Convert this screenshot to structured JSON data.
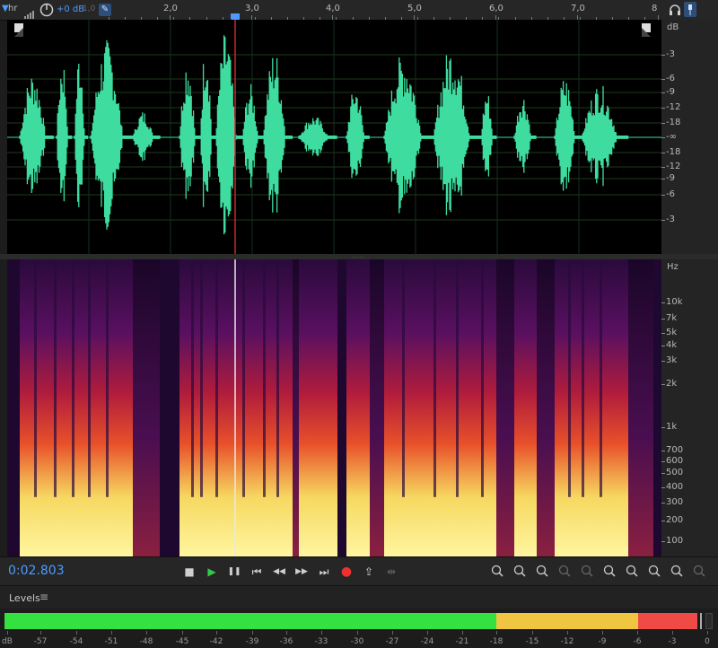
{
  "ruler": {
    "left_labels": {
      "partial": "hr",
      "gain": "+0 dB",
      "faint": "1,0"
    },
    "ticks": [
      "2,0",
      "3,0",
      "4,0",
      "5,0",
      "6,0",
      "7,0",
      "8"
    ]
  },
  "db_scale": {
    "unit": "dB",
    "top_labels": [
      "-3",
      "-6",
      "-9",
      "-12",
      "-18"
    ],
    "center": "-∞",
    "bottom_labels": [
      "-18",
      "-12",
      "-9",
      "-6",
      "-3"
    ]
  },
  "hz_scale": {
    "unit": "Hz",
    "labels": [
      "10k",
      "7k",
      "5k",
      "4k",
      "3k",
      "2k",
      "1k",
      "700",
      "600",
      "500",
      "400",
      "300",
      "200",
      "100"
    ]
  },
  "transport": {
    "time": "0:02.803",
    "buttons": {
      "stop": "■",
      "play": "▶",
      "pause": "❚❚",
      "to_start": "⏮",
      "rewind": "◀◀",
      "forward": "▶▶",
      "to_end": "⏭",
      "record": "●",
      "loop": "⇪",
      "skip": "⇹"
    }
  },
  "levels": {
    "title": "Levels",
    "scale": [
      "dB",
      "-57",
      "-54",
      "-51",
      "-48",
      "-45",
      "-42",
      "-39",
      "-36",
      "-33",
      "-30",
      "-27",
      "-24",
      "-21",
      "-18",
      "-15",
      "-12",
      "-9",
      "-6",
      "-3",
      "0"
    ],
    "colors": {
      "green": "#35e140",
      "yellow": "#f0c542",
      "red": "#ef4a45"
    }
  },
  "colors": {
    "waveform": "#3fdca0",
    "playhead": "#d22626",
    "accent": "#4d9bff",
    "background": "#1d1d1d"
  }
}
